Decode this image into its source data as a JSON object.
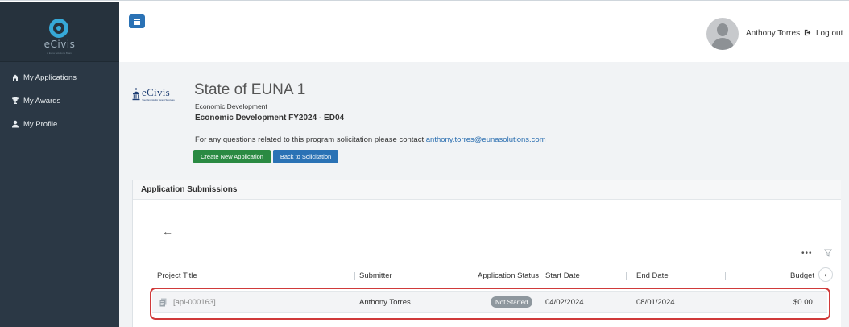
{
  "brand": {
    "app_logo_text": "eCivis",
    "app_logo_sub": "A Euna Solutions Brand",
    "org_logo_text": "eCivis",
    "org_logo_tag": "Your Grants for Grant Success"
  },
  "sidebar": {
    "items": [
      {
        "label": "My Applications",
        "icon": "home-icon"
      },
      {
        "label": "My Awards",
        "icon": "trophy-icon"
      },
      {
        "label": "My Profile",
        "icon": "user-icon"
      }
    ]
  },
  "topbar": {
    "user_name": "Anthony Torres",
    "logout_label": "Log out"
  },
  "header": {
    "title": "State of EUNA 1",
    "subtitle": "Economic Development",
    "program": "Economic Development FY2024 - ED04",
    "contact_prefix": "For any questions related to this program solicitation please contact ",
    "contact_email": "anthony.torres@eunasolutions.com",
    "create_button": "Create New Application",
    "back_button": "Back to Solicitation"
  },
  "panel": {
    "title": "Application Submissions",
    "back_icon": "←",
    "more_icon": "•••"
  },
  "table": {
    "columns": [
      "Project Title",
      "Submitter",
      "Application Status",
      "Start Date",
      "End Date",
      "Budget"
    ],
    "rows": [
      {
        "project_title": "[api-000163]",
        "submitter": "Anthony Torres",
        "status": "Not Started",
        "start_date": "04/02/2024",
        "end_date": "08/01/2024",
        "budget": "$0.00"
      }
    ]
  },
  "colors": {
    "sidebar_bg": "#2b3845",
    "primary_blue": "#2a72b5",
    "success_green": "#2a8a42",
    "highlight_red": "#d03a3a",
    "status_gray": "#8e979e"
  }
}
